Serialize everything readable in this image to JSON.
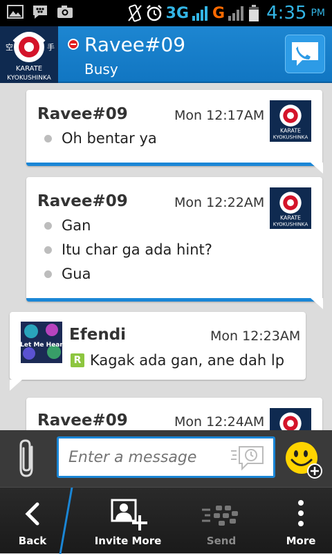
{
  "status_bar": {
    "network_3g": "3G",
    "network_g": "G",
    "time": "4:35",
    "ampm": "PM"
  },
  "header": {
    "contact_name": "Ravee#09",
    "contact_status": "Busy",
    "avatar_text_top": "KARATE",
    "avatar_text_bottom": "KYOKUSHINKA"
  },
  "messages": [
    {
      "sender": "Ravee#09",
      "time": "Mon 12:17AM",
      "lines": [
        "Oh bentar ya"
      ]
    },
    {
      "sender": "Ravee#09",
      "time": "Mon 12:22AM",
      "lines": [
        "Gan",
        "Itu char ga ada hint?",
        "Gua"
      ]
    },
    {
      "sender": "Efendi",
      "time": "Mon 12:23AM",
      "badge": "R",
      "lines": [
        "Kagak ada gan, ane dah lp"
      ],
      "avatar_text": "Let Me Hear"
    },
    {
      "sender": "Ravee#09",
      "time": "Mon 12:24AM",
      "lines": []
    }
  ],
  "input": {
    "placeholder": "Enter a message"
  },
  "nav": {
    "back": "Back",
    "invite_more": "Invite More",
    "send": "Send",
    "more": "More"
  },
  "colors": {
    "accent": "#1a86d6",
    "presence_busy": "#e21c1c",
    "status_blue": "#33b5e5",
    "status_orange": "#ff6a00",
    "badge_green": "#8dc63f"
  }
}
